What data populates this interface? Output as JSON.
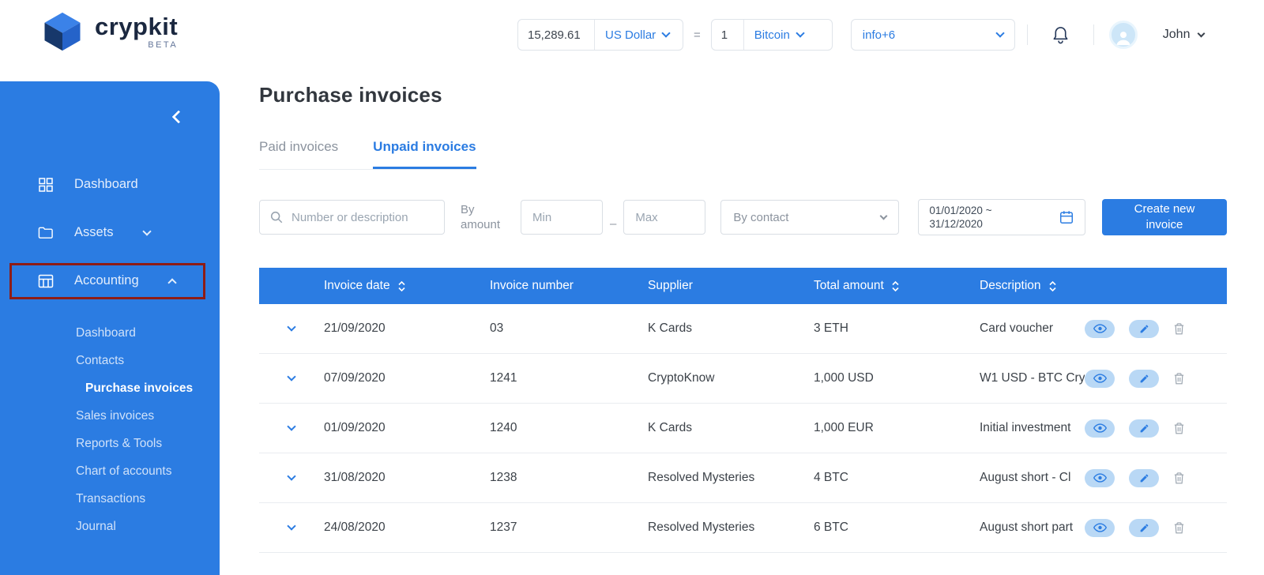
{
  "colors": {
    "primary_blue": "#2b7ce2",
    "brand_navy": "#1b2840",
    "annotation_red": "#8e1c16",
    "action_pill_bg": "#b9d8f5",
    "muted_text": "#8b939e"
  },
  "icons": {
    "logo": "isometric-cube",
    "search": "magnifier",
    "calendar": "calendar",
    "bell": "notification-bell",
    "sort": "up-down-chevrons",
    "view": "eye",
    "edit": "pencil",
    "delete": "trash",
    "collapse": "chevron-left",
    "expand_row": "chevron-down"
  },
  "header": {
    "brand": "crypkit",
    "beta_label": "BETA",
    "converter": {
      "fiat_amount": "15,289.61",
      "fiat_currency": "US Dollar",
      "equals_sign": "=",
      "crypto_amount": "1",
      "crypto_currency": "Bitcoin"
    },
    "info_dropdown_value": "info+6",
    "user_name": "John"
  },
  "sidebar": {
    "items": [
      {
        "label": "Dashboard"
      },
      {
        "label": "Assets"
      },
      {
        "label": "Accounting"
      }
    ],
    "submenu": {
      "items": [
        "Dashboard",
        "Contacts",
        "Purchase invoices",
        "Sales invoices",
        "Reports & Tools",
        "Chart of accounts",
        "Transactions",
        "Journal"
      ],
      "active": "Purchase invoices"
    }
  },
  "main": {
    "page_title": "Purchase invoices",
    "tabs": {
      "paid": "Paid invoices",
      "unpaid": "Unpaid invoices",
      "active": "Unpaid invoices"
    },
    "filters": {
      "search_placeholder": "Number or description",
      "amount_label": "By amount",
      "min_placeholder": "Min",
      "max_placeholder": "Max",
      "separator": "–",
      "contact_value": "By contact",
      "date_line1": "01/01/2020 ~",
      "date_line2": "31/12/2020",
      "create_button": "Create new invoice"
    },
    "table": {
      "headers": {
        "date": "Invoice date",
        "number": "Invoice number",
        "supplier": "Supplier",
        "amount": "Total amount",
        "description": "Description"
      },
      "rows": [
        {
          "date": "21/09/2020",
          "number": "03",
          "supplier": "K Cards",
          "amount": "3 ETH",
          "description": "Card voucher"
        },
        {
          "date": "07/09/2020",
          "number": "1241",
          "supplier": "CryptoKnow",
          "amount": "1,000 USD",
          "description": "W1 USD - BTC Cryp"
        },
        {
          "date": "01/09/2020",
          "number": "1240",
          "supplier": "K Cards",
          "amount": "1,000 EUR",
          "description": "Initial investment"
        },
        {
          "date": "31/08/2020",
          "number": "1238",
          "supplier": "Resolved Mysteries",
          "amount": "4 BTC",
          "description": "August short - Cl"
        },
        {
          "date": "24/08/2020",
          "number": "1237",
          "supplier": "Resolved Mysteries",
          "amount": "6 BTC",
          "description": "August short part"
        }
      ]
    }
  }
}
